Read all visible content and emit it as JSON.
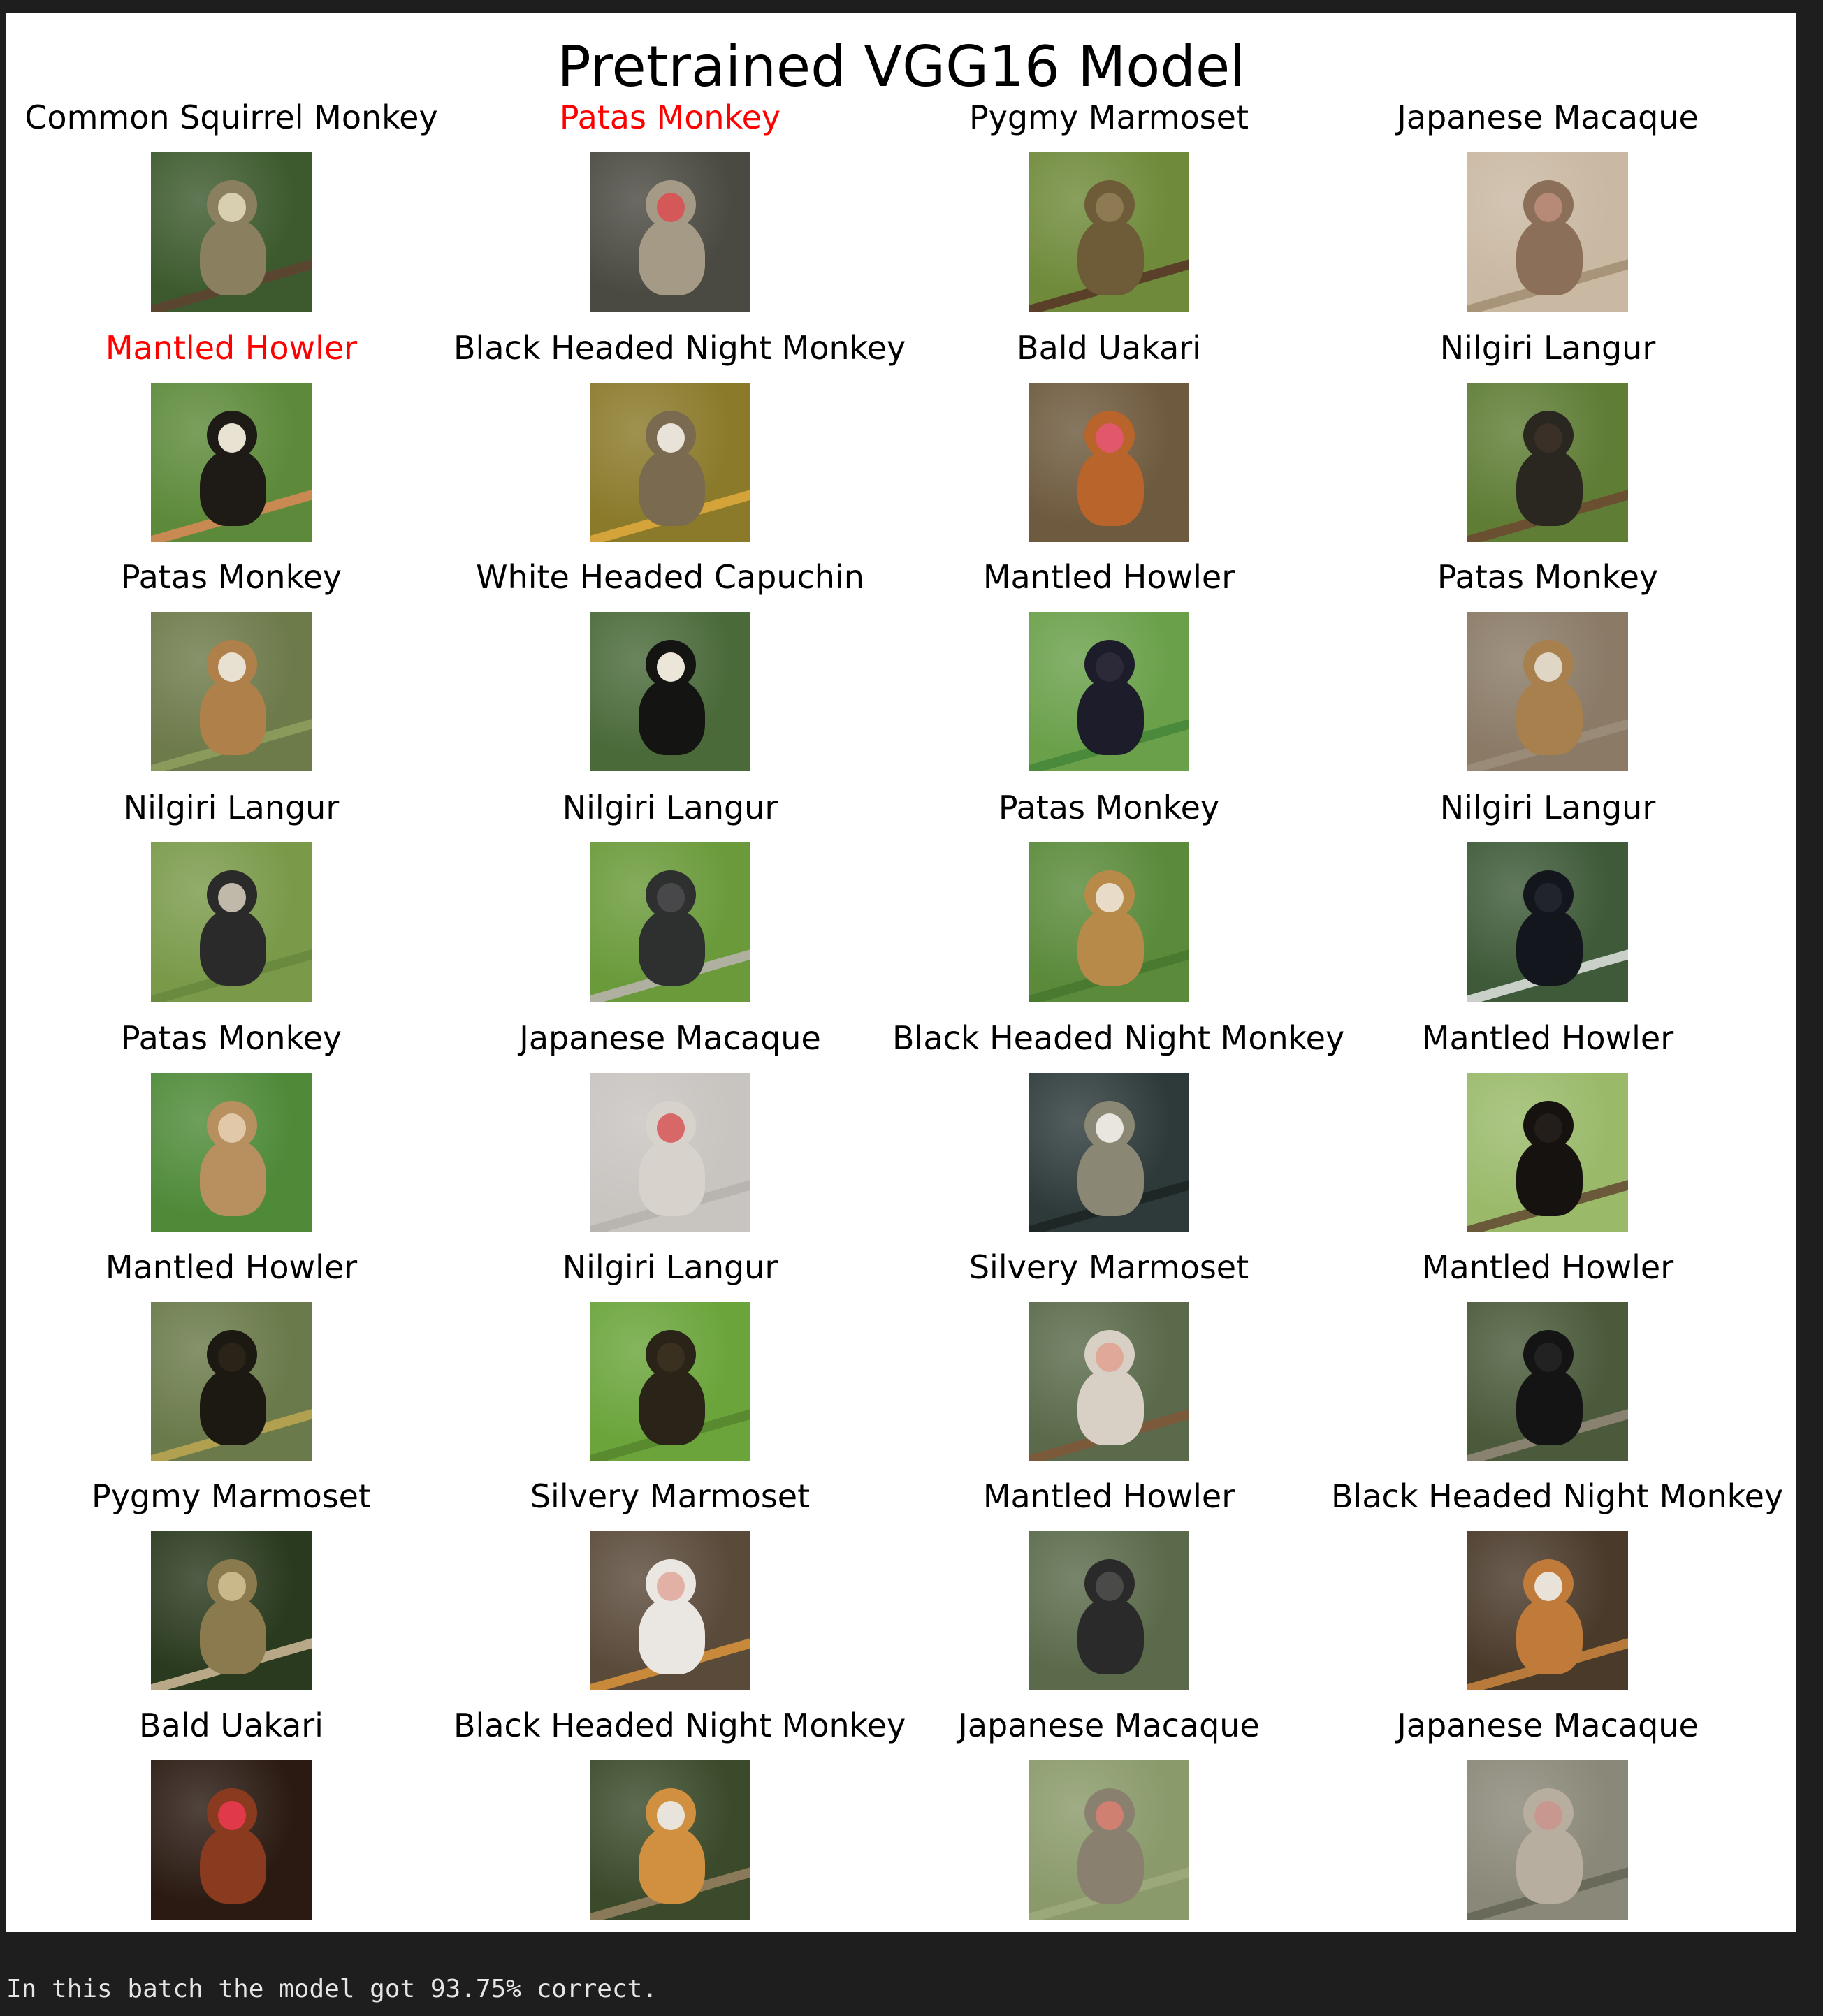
{
  "figure": {
    "title": "Pretrained VGG16 Model",
    "label_color_correct": "#000000",
    "label_color_wrong": "#ff0000",
    "grid": [
      {
        "label": "Common Squirrel Monkey",
        "wrong": false,
        "bg": "#3d5a2e",
        "fur": "#8a8060",
        "face": "#d8cfb0",
        "branch": "#5a4630"
      },
      {
        "label": "Patas Monkey",
        "wrong": true,
        "bg": "#4a4a42",
        "fur": "#a49a86",
        "face": "#d45858",
        "branch": "#4a4a42"
      },
      {
        "label": "Pygmy Marmoset",
        "wrong": false,
        "bg": "#6f8a3a",
        "fur": "#6e5c38",
        "face": "#8d7a52",
        "branch": "#5a4028"
      },
      {
        "label": "Japanese Macaque",
        "wrong": false,
        "bg": "#c9b8a2",
        "fur": "#8b6f58",
        "face": "#b78a78",
        "branch": "#a89478"
      },
      {
        "label": "Mantled Howler",
        "wrong": true,
        "bg": "#5d8a3a",
        "fur": "#1e1a16",
        "face": "#e8e2d2",
        "branch": "#c88a52"
      },
      {
        "label": "Black Headed Night Monkey",
        "wrong": false,
        "bg": "#8a7a2a",
        "fur": "#7a6a50",
        "face": "#e8e2d8",
        "branch": "#d4a43a"
      },
      {
        "label": "Bald Uakari",
        "wrong": false,
        "bg": "#6e5a3e",
        "fur": "#b8642a",
        "face": "#e0586a",
        "branch": "#6e5a3e"
      },
      {
        "label": "Nilgiri Langur",
        "wrong": false,
        "bg": "#5f7d35",
        "fur": "#2a2620",
        "face": "#3a3028",
        "branch": "#6a5030"
      },
      {
        "label": "Patas Monkey",
        "wrong": false,
        "bg": "#6d7a4a",
        "fur": "#b0804a",
        "face": "#e8e0d0",
        "branch": "#8a9a5a"
      },
      {
        "label": "White Headed Capuchin",
        "wrong": false,
        "bg": "#4a6a3a",
        "fur": "#141412",
        "face": "#ece6d8",
        "branch": "#4a6a3a"
      },
      {
        "label": "Mantled Howler",
        "wrong": false,
        "bg": "#6aa04a",
        "fur": "#1c1c2a",
        "face": "#2c2a38",
        "branch": "#4a8a3a"
      },
      {
        "label": "Patas Monkey",
        "wrong": false,
        "bg": "#8a7a66",
        "fur": "#a8804e",
        "face": "#e0d6c6",
        "branch": "#9a8a78"
      },
      {
        "label": "Nilgiri Langur",
        "wrong": false,
        "bg": "#7a9a4a",
        "fur": "#2a2a2a",
        "face": "#c0b8a8",
        "branch": "#6a8a40"
      },
      {
        "label": "Nilgiri Langur",
        "wrong": false,
        "bg": "#6a9a3a",
        "fur": "#2e3030",
        "face": "#48484a",
        "branch": "#b0b0a0"
      },
      {
        "label": "Patas Monkey",
        "wrong": false,
        "bg": "#5a8a3a",
        "fur": "#b88a4a",
        "face": "#e8dcc8",
        "branch": "#4a7a30"
      },
      {
        "label": "Nilgiri Langur",
        "wrong": false,
        "bg": "#3e5a38",
        "fur": "#14161e",
        "face": "#22242c",
        "branch": "#c8d0c8"
      },
      {
        "label": "Patas Monkey",
        "wrong": false,
        "bg": "#4e8a38",
        "fur": "#b89060",
        "face": "#e0c8a8",
        "branch": "#4e8a38"
      },
      {
        "label": "Japanese Macaque",
        "wrong": false,
        "bg": "#c8c4c0",
        "fur": "#d8d2cc",
        "face": "#d86868",
        "branch": "#b8b4b0"
      },
      {
        "label": "Black Headed Night Monkey",
        "wrong": false,
        "bg": "#2e3a3a",
        "fur": "#8a8874",
        "face": "#e8e6de",
        "branch": "#1e2626"
      },
      {
        "label": "Mantled Howler",
        "wrong": false,
        "bg": "#9aba6a",
        "fur": "#161210",
        "face": "#241e1a",
        "branch": "#6a5a3a"
      },
      {
        "label": "Mantled Howler",
        "wrong": false,
        "bg": "#6a7a4a",
        "fur": "#1c1812",
        "face": "#2a2418",
        "branch": "#b0a050"
      },
      {
        "label": "Nilgiri Langur",
        "wrong": false,
        "bg": "#6aa43a",
        "fur": "#2a2418",
        "face": "#3a3020",
        "branch": "#5a8a30"
      },
      {
        "label": "Silvery Marmoset",
        "wrong": false,
        "bg": "#5a6a4a",
        "fur": "#d8d0c4",
        "face": "#e0a898",
        "branch": "#7a5a3a"
      },
      {
        "label": "Mantled Howler",
        "wrong": false,
        "bg": "#4a5a3a",
        "fur": "#141414",
        "face": "#222222",
        "branch": "#8a8270"
      },
      {
        "label": "Pygmy Marmoset",
        "wrong": false,
        "bg": "#2a3a1e",
        "fur": "#8a7a4e",
        "face": "#c8b88a",
        "branch": "#b8a888"
      },
      {
        "label": "Silvery Marmoset",
        "wrong": false,
        "bg": "#5a4a3a",
        "fur": "#eae6e2",
        "face": "#e2b0a4",
        "branch": "#c88a3a"
      },
      {
        "label": "Mantled Howler",
        "wrong": false,
        "bg": "#5a6a4a",
        "fur": "#2a2a2a",
        "face": "#4a4a48",
        "branch": "#5a6a4a"
      },
      {
        "label": "Black Headed Night Monkey",
        "wrong": false,
        "bg": "#4a3a2a",
        "fur": "#c07a3a",
        "face": "#e8e2d8",
        "branch": "#b87a3a"
      },
      {
        "label": "Bald Uakari",
        "wrong": false,
        "bg": "#2a1a12",
        "fur": "#8a3a1e",
        "face": "#e03a4a",
        "branch": "#2a1a12"
      },
      {
        "label": "Black Headed Night Monkey",
        "wrong": false,
        "bg": "#3a4a2a",
        "fur": "#d09040",
        "face": "#e8e4dc",
        "branch": "#8a7a5a"
      },
      {
        "label": "Japanese Macaque",
        "wrong": false,
        "bg": "#8a9a6a",
        "fur": "#8a8070",
        "face": "#d08070",
        "branch": "#9aa87a"
      },
      {
        "label": "Japanese Macaque",
        "wrong": false,
        "bg": "#8a8878",
        "fur": "#b8aea0",
        "face": "#c89890",
        "branch": "#6a6a5a"
      }
    ]
  },
  "console": {
    "output": "In this batch the model got 93.75% correct."
  }
}
